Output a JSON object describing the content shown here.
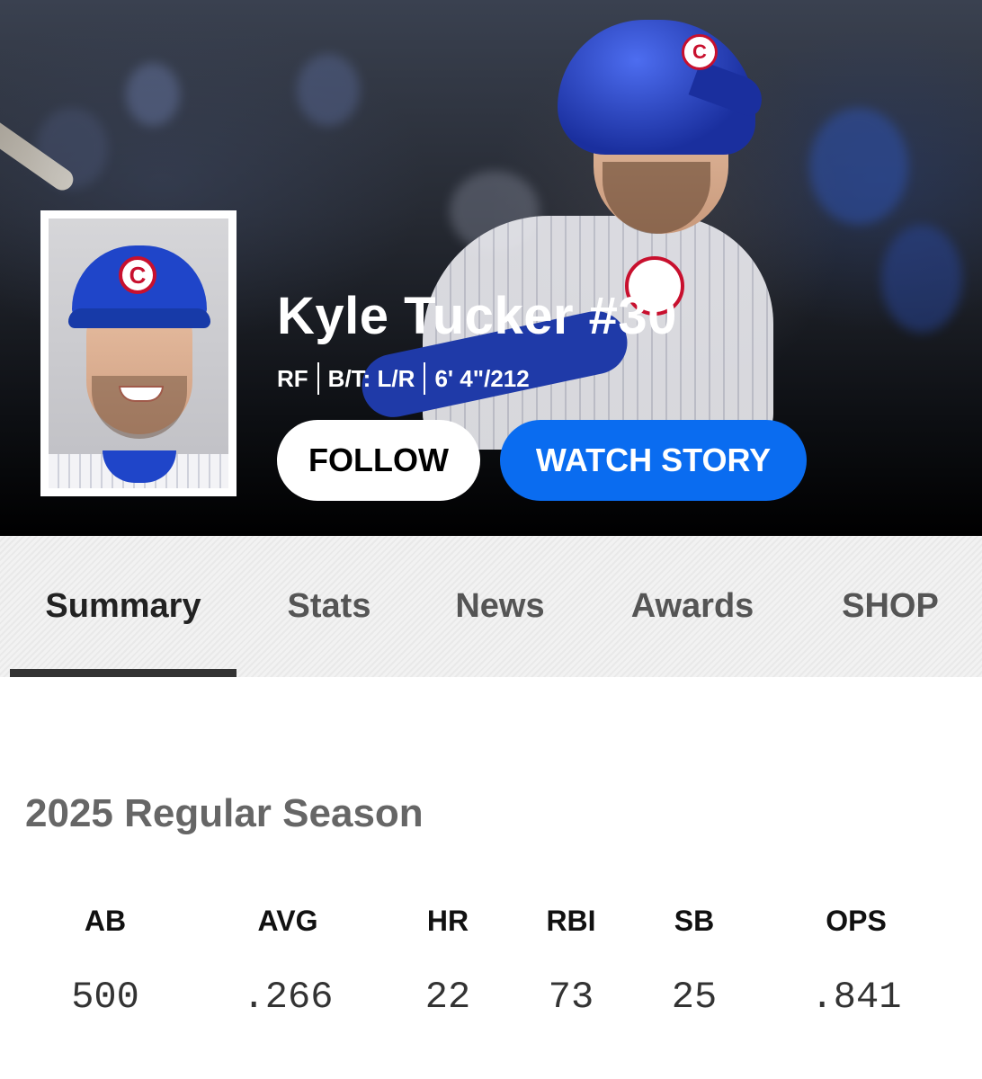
{
  "player": {
    "name": "Kyle Tucker #30",
    "position": "RF",
    "bats_throws": "B/T: L/R",
    "height_weight": "6' 4\"/212"
  },
  "actions": {
    "follow_label": "FOLLOW",
    "watch_story_label": "WATCH STORY"
  },
  "tabs": [
    {
      "label": "Summary",
      "active": true
    },
    {
      "label": "Stats",
      "active": false
    },
    {
      "label": "News",
      "active": false
    },
    {
      "label": "Awards",
      "active": false
    },
    {
      "label": "SHOP",
      "active": false
    }
  ],
  "season": {
    "title": "2025 Regular Season",
    "stats": [
      {
        "label": "AB",
        "value": "500"
      },
      {
        "label": "AVG",
        "value": ".266"
      },
      {
        "label": "HR",
        "value": "22"
      },
      {
        "label": "RBI",
        "value": "73"
      },
      {
        "label": "SB",
        "value": "25"
      },
      {
        "label": "OPS",
        "value": ".841"
      }
    ]
  },
  "colors": {
    "watch_button": "#0a6cf0",
    "follow_button": "#ffffff",
    "team_blue": "#1f45c9",
    "team_red": "#c8102e"
  },
  "images": {
    "hero_background": "player-batting-photo",
    "headshot": "player-headshot-photo",
    "team_logo_letter": "C"
  }
}
